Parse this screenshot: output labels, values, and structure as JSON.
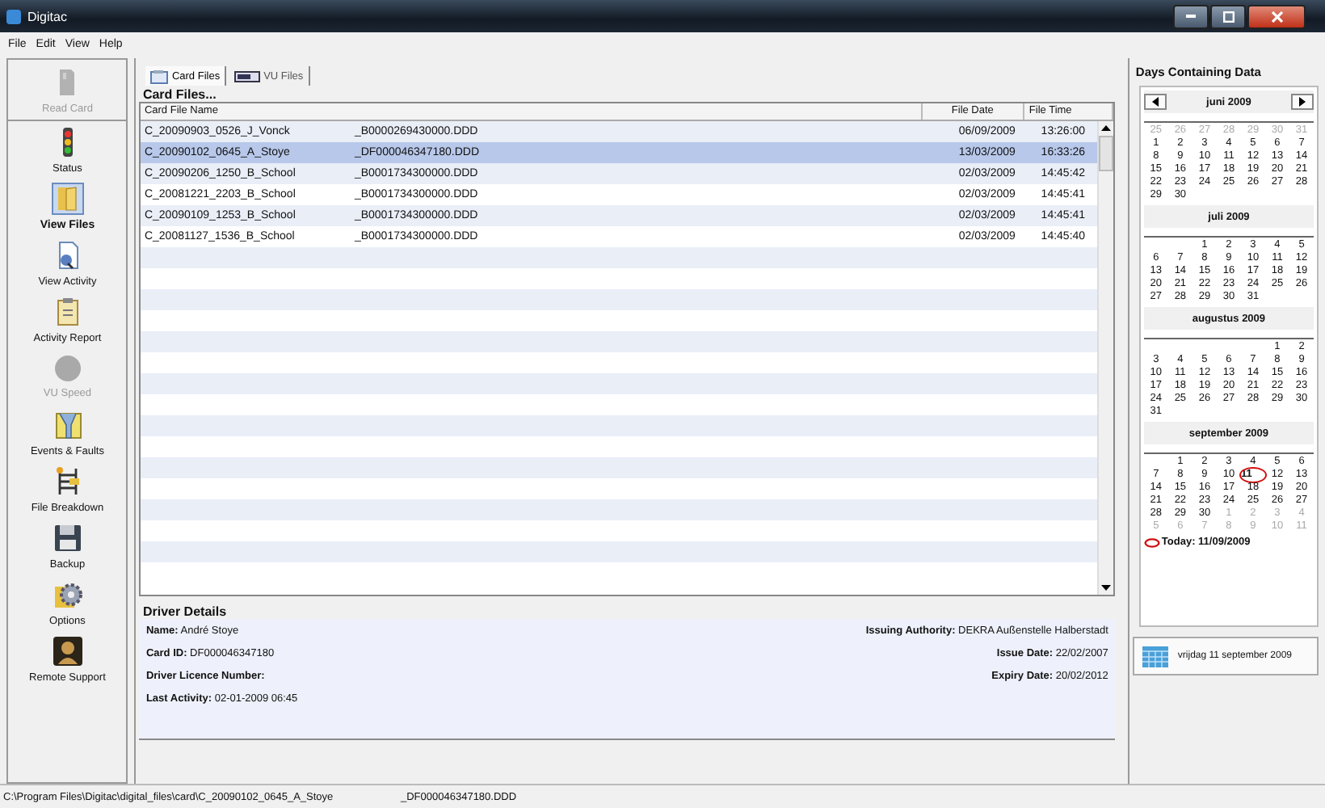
{
  "window": {
    "title": "Digitac"
  },
  "menu": [
    "File",
    "Edit",
    "View",
    "Help"
  ],
  "sidebar": {
    "items": [
      {
        "label": "Read Card",
        "disabled": true,
        "selected": false
      },
      {
        "label": "Status",
        "disabled": false,
        "selected": false
      },
      {
        "label": "View Files",
        "disabled": false,
        "selected": true
      },
      {
        "label": "View Activity",
        "disabled": false,
        "selected": false
      },
      {
        "label": "Activity Report",
        "disabled": false,
        "selected": false
      },
      {
        "label": "VU Speed",
        "disabled": true,
        "selected": false
      },
      {
        "label": "Events & Faults",
        "disabled": false,
        "selected": false
      },
      {
        "label": "File Breakdown",
        "disabled": false,
        "selected": false
      },
      {
        "label": "Backup",
        "disabled": false,
        "selected": false
      },
      {
        "label": "Options",
        "disabled": false,
        "selected": false
      },
      {
        "label": "Remote Support",
        "disabled": false,
        "selected": false
      }
    ]
  },
  "tabs": [
    {
      "label": "Card Files",
      "selected": true
    },
    {
      "label": "VU Files",
      "selected": false
    }
  ],
  "table": {
    "title": "Card Files...",
    "columns": [
      "Card File Name",
      "File Date",
      "File Time"
    ],
    "rows": [
      {
        "name": "C_20090903_0526_J_Vonck",
        "file": "_B0000269430000.DDD",
        "date": "06/09/2009",
        "time": "13:26:00",
        "selected": false
      },
      {
        "name": "C_20090102_0645_A_Stoye",
        "file": "_DF000046347180.DDD",
        "date": "13/03/2009",
        "time": "16:33:26",
        "selected": true
      },
      {
        "name": "C_20090206_1250_B_School",
        "file": "_B0001734300000.DDD",
        "date": "02/03/2009",
        "time": "14:45:42",
        "selected": false
      },
      {
        "name": "C_20081221_2203_B_School",
        "file": "_B0001734300000.DDD",
        "date": "02/03/2009",
        "time": "14:45:41",
        "selected": false
      },
      {
        "name": "C_20090109_1253_B_School",
        "file": "_B0001734300000.DDD",
        "date": "02/03/2009",
        "time": "14:45:41",
        "selected": false
      },
      {
        "name": "C_20081127_1536_B_School",
        "file": "_B0001734300000.DDD",
        "date": "02/03/2009",
        "time": "14:45:40",
        "selected": false
      }
    ]
  },
  "driver_details": {
    "title": "Driver Details",
    "left": [
      {
        "label": "Name:",
        "value": "André Stoye"
      },
      {
        "label": "Card ID:",
        "value": "DF000046347180"
      },
      {
        "label": "Driver Licence Number:"
      },
      {
        "label": "Last Activity:",
        "value": "02-01-2009 06:45"
      }
    ],
    "right": [
      {
        "label": "Issuing Authority:",
        "value": "DEKRA Außenstelle Halberstadt"
      },
      {
        "label": "Issue Date:",
        "value": "22/02/2007"
      },
      {
        "label": "Expiry Date:",
        "value": "20/02/2012"
      }
    ]
  },
  "calendar": {
    "title": "Days Containing Data",
    "today": "Today: 11/09/2009",
    "months": [
      {
        "title": "juni 2009",
        "arrows": true,
        "cells": [
          {
            "kind": "other",
            "day": "25"
          },
          {
            "kind": "other",
            "day": "26"
          },
          {
            "kind": "other",
            "day": "27"
          },
          {
            "kind": "other",
            "day": "28"
          },
          {
            "kind": "other",
            "day": "29"
          },
          {
            "kind": "other",
            "day": "30"
          },
          {
            "kind": "other",
            "day": "31"
          },
          {
            "kind": "day",
            "day": "1"
          },
          {
            "kind": "day",
            "day": "2"
          },
          {
            "kind": "day",
            "day": "3"
          },
          {
            "kind": "day",
            "day": "4"
          },
          {
            "kind": "day",
            "day": "5"
          },
          {
            "kind": "day",
            "day": "6"
          },
          {
            "kind": "day",
            "day": "7"
          },
          {
            "kind": "day",
            "day": "8"
          },
          {
            "kind": "day",
            "day": "9"
          },
          {
            "kind": "day",
            "day": "10"
          },
          {
            "kind": "day",
            "day": "11"
          },
          {
            "kind": "day",
            "day": "12"
          },
          {
            "kind": "day",
            "day": "13"
          },
          {
            "kind": "day",
            "day": "14"
          },
          {
            "kind": "day",
            "day": "15"
          },
          {
            "kind": "day",
            "day": "16"
          },
          {
            "kind": "day",
            "day": "17"
          },
          {
            "kind": "day",
            "day": "18"
          },
          {
            "kind": "day",
            "day": "19"
          },
          {
            "kind": "day",
            "day": "20"
          },
          {
            "kind": "day",
            "day": "21"
          },
          {
            "kind": "day",
            "day": "22"
          },
          {
            "kind": "day",
            "day": "23"
          },
          {
            "kind": "day",
            "day": "24"
          },
          {
            "kind": "day",
            "day": "25"
          },
          {
            "kind": "day",
            "day": "26"
          },
          {
            "kind": "day",
            "day": "27"
          },
          {
            "kind": "day",
            "day": "28"
          },
          {
            "kind": "day",
            "day": "29"
          },
          {
            "kind": "day",
            "day": "30"
          }
        ]
      },
      {
        "title": "juli 2009",
        "arrows": false,
        "cells": [
          {
            "kind": "blank"
          },
          {
            "kind": "blank"
          },
          {
            "kind": "day",
            "day": "1"
          },
          {
            "kind": "day",
            "day": "2"
          },
          {
            "kind": "day",
            "day": "3"
          },
          {
            "kind": "day",
            "day": "4"
          },
          {
            "kind": "day",
            "day": "5"
          },
          {
            "kind": "day",
            "day": "6"
          },
          {
            "kind": "day",
            "day": "7"
          },
          {
            "kind": "day",
            "day": "8"
          },
          {
            "kind": "day",
            "day": "9"
          },
          {
            "kind": "day",
            "day": "10"
          },
          {
            "kind": "day",
            "day": "11"
          },
          {
            "kind": "day",
            "day": "12"
          },
          {
            "kind": "day",
            "day": "13"
          },
          {
            "kind": "day",
            "day": "14"
          },
          {
            "kind": "day",
            "day": "15"
          },
          {
            "kind": "day",
            "day": "16"
          },
          {
            "kind": "day",
            "day": "17"
          },
          {
            "kind": "day",
            "day": "18"
          },
          {
            "kind": "day",
            "day": "19"
          },
          {
            "kind": "day",
            "day": "20"
          },
          {
            "kind": "day",
            "day": "21"
          },
          {
            "kind": "day",
            "day": "22"
          },
          {
            "kind": "day",
            "day": "23"
          },
          {
            "kind": "day",
            "day": "24"
          },
          {
            "kind": "day",
            "day": "25"
          },
          {
            "kind": "day",
            "day": "26"
          },
          {
            "kind": "day",
            "day": "27"
          },
          {
            "kind": "day",
            "day": "28"
          },
          {
            "kind": "day",
            "day": "29"
          },
          {
            "kind": "day",
            "day": "30"
          },
          {
            "kind": "day",
            "day": "31"
          }
        ]
      },
      {
        "title": "augustus 2009",
        "arrows": false,
        "cells": [
          {
            "kind": "blank"
          },
          {
            "kind": "blank"
          },
          {
            "kind": "blank"
          },
          {
            "kind": "blank"
          },
          {
            "kind": "blank"
          },
          {
            "kind": "day",
            "day": "1"
          },
          {
            "kind": "day",
            "day": "2"
          },
          {
            "kind": "day",
            "day": "3"
          },
          {
            "kind": "day",
            "day": "4"
          },
          {
            "kind": "day",
            "day": "5"
          },
          {
            "kind": "day",
            "day": "6"
          },
          {
            "kind": "day",
            "day": "7"
          },
          {
            "kind": "day",
            "day": "8"
          },
          {
            "kind": "day",
            "day": "9"
          },
          {
            "kind": "day",
            "day": "10"
          },
          {
            "kind": "day",
            "day": "11"
          },
          {
            "kind": "day",
            "day": "12"
          },
          {
            "kind": "day",
            "day": "13"
          },
          {
            "kind": "day",
            "day": "14"
          },
          {
            "kind": "day",
            "day": "15"
          },
          {
            "kind": "day",
            "day": "16"
          },
          {
            "kind": "day",
            "day": "17"
          },
          {
            "kind": "day",
            "day": "18"
          },
          {
            "kind": "day",
            "day": "19"
          },
          {
            "kind": "day",
            "day": "20"
          },
          {
            "kind": "day",
            "day": "21"
          },
          {
            "kind": "day",
            "day": "22"
          },
          {
            "kind": "day",
            "day": "23"
          },
          {
            "kind": "day",
            "day": "24"
          },
          {
            "kind": "day",
            "day": "25"
          },
          {
            "kind": "day",
            "day": "26"
          },
          {
            "kind": "day",
            "day": "27"
          },
          {
            "kind": "day",
            "day": "28"
          },
          {
            "kind": "day",
            "day": "29"
          },
          {
            "kind": "day",
            "day": "30"
          },
          {
            "kind": "day",
            "day": "31"
          }
        ]
      },
      {
        "title": "september 2009",
        "arrows": false,
        "cells": [
          {
            "kind": "blank"
          },
          {
            "kind": "day",
            "day": "1"
          },
          {
            "kind": "day",
            "day": "2"
          },
          {
            "kind": "day",
            "day": "3"
          },
          {
            "kind": "day",
            "day": "4"
          },
          {
            "kind": "day",
            "day": "5"
          },
          {
            "kind": "day",
            "day": "6"
          },
          {
            "kind": "day",
            "day": "7"
          },
          {
            "kind": "day",
            "day": "8"
          },
          {
            "kind": "day",
            "day": "9"
          },
          {
            "kind": "day",
            "day": "10"
          },
          {
            "kind": "today",
            "day": "11"
          },
          {
            "kind": "day",
            "day": "12"
          },
          {
            "kind": "day",
            "day": "13"
          },
          {
            "kind": "day",
            "day": "14"
          },
          {
            "kind": "day",
            "day": "15"
          },
          {
            "kind": "day",
            "day": "16"
          },
          {
            "kind": "day",
            "day": "17"
          },
          {
            "kind": "day",
            "day": "18"
          },
          {
            "kind": "day",
            "day": "19"
          },
          {
            "kind": "day",
            "day": "20"
          },
          {
            "kind": "day",
            "day": "21"
          },
          {
            "kind": "day",
            "day": "22"
          },
          {
            "kind": "day",
            "day": "23"
          },
          {
            "kind": "day",
            "day": "24"
          },
          {
            "kind": "day",
            "day": "25"
          },
          {
            "kind": "day",
            "day": "26"
          },
          {
            "kind": "day",
            "day": "27"
          },
          {
            "kind": "day",
            "day": "28"
          },
          {
            "kind": "day",
            "day": "29"
          },
          {
            "kind": "day",
            "day": "30"
          },
          {
            "kind": "other",
            "day": "1"
          },
          {
            "kind": "other",
            "day": "2"
          },
          {
            "kind": "other",
            "day": "3"
          },
          {
            "kind": "other",
            "day": "4"
          },
          {
            "kind": "other",
            "day": "5"
          },
          {
            "kind": "other",
            "day": "6"
          },
          {
            "kind": "other",
            "day": "7"
          },
          {
            "kind": "other",
            "day": "8"
          },
          {
            "kind": "other",
            "day": "9"
          },
          {
            "kind": "other",
            "day": "10"
          },
          {
            "kind": "other",
            "day": "11"
          }
        ]
      }
    ]
  },
  "status_bar": {
    "path": "C:\\Program Files\\Digitac\\digital_files\\card\\C_20090102_0645_A_Stoye",
    "file": "_DF000046347180.DDD"
  },
  "clock": {
    "date": "vrijdag 11 september 2009"
  }
}
